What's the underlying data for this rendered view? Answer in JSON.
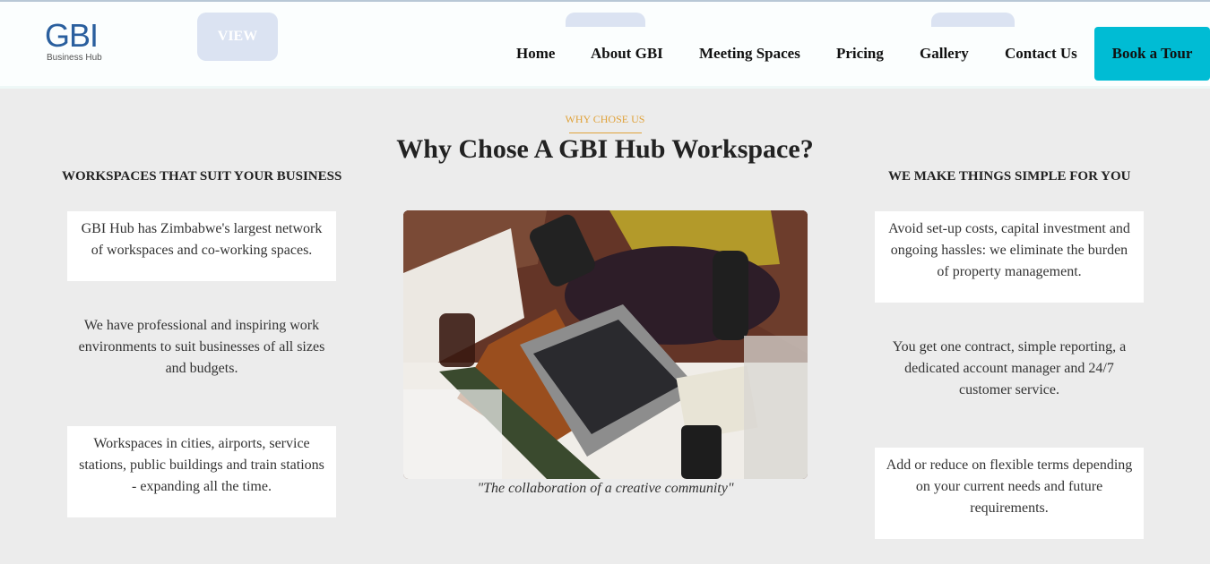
{
  "header": {
    "logo": {
      "mark": "GBI",
      "sub": "Business Hub"
    },
    "ghost_button_label": "VIEW",
    "nav": [
      {
        "label": "Home"
      },
      {
        "label": "About GBI"
      },
      {
        "label": "Meeting Spaces"
      },
      {
        "label": "Pricing"
      },
      {
        "label": "Gallery"
      },
      {
        "label": "Contact Us"
      }
    ],
    "cta_label": "Book a Tour"
  },
  "section": {
    "eyebrow": "WHY CHOSE US",
    "title": "Why Chose A GBI Hub Workspace?",
    "left": {
      "heading": "WORKSPACES THAT SUIT YOUR BUSINESS",
      "cards": [
        "GBI Hub has Zimbabwe's largest network of workspaces and co-working spaces.",
        "We have professional and inspiring work environments to suit businesses of all sizes and budgets.",
        "Workspaces in cities, airports, service stations, public buildings and train stations - expanding all the time."
      ]
    },
    "right": {
      "heading": "WE MAKE THINGS SIMPLE FOR YOU",
      "cards": [
        "Avoid set-up costs, capital investment and ongoing hassles: we eliminate the burden of property management.",
        "You get one contract, simple reporting, a dedicated account manager and 24/7 customer service.",
        "Add or reduce on flexible terms depending on your current needs and future requirements."
      ]
    },
    "caption": "\"The collaboration of a creative community\""
  },
  "colors": {
    "brand_blue": "#2a5f9e",
    "accent_cyan": "#00bcd4",
    "eyebrow_gold": "#e0a23a",
    "page_bg": "#ececec"
  }
}
